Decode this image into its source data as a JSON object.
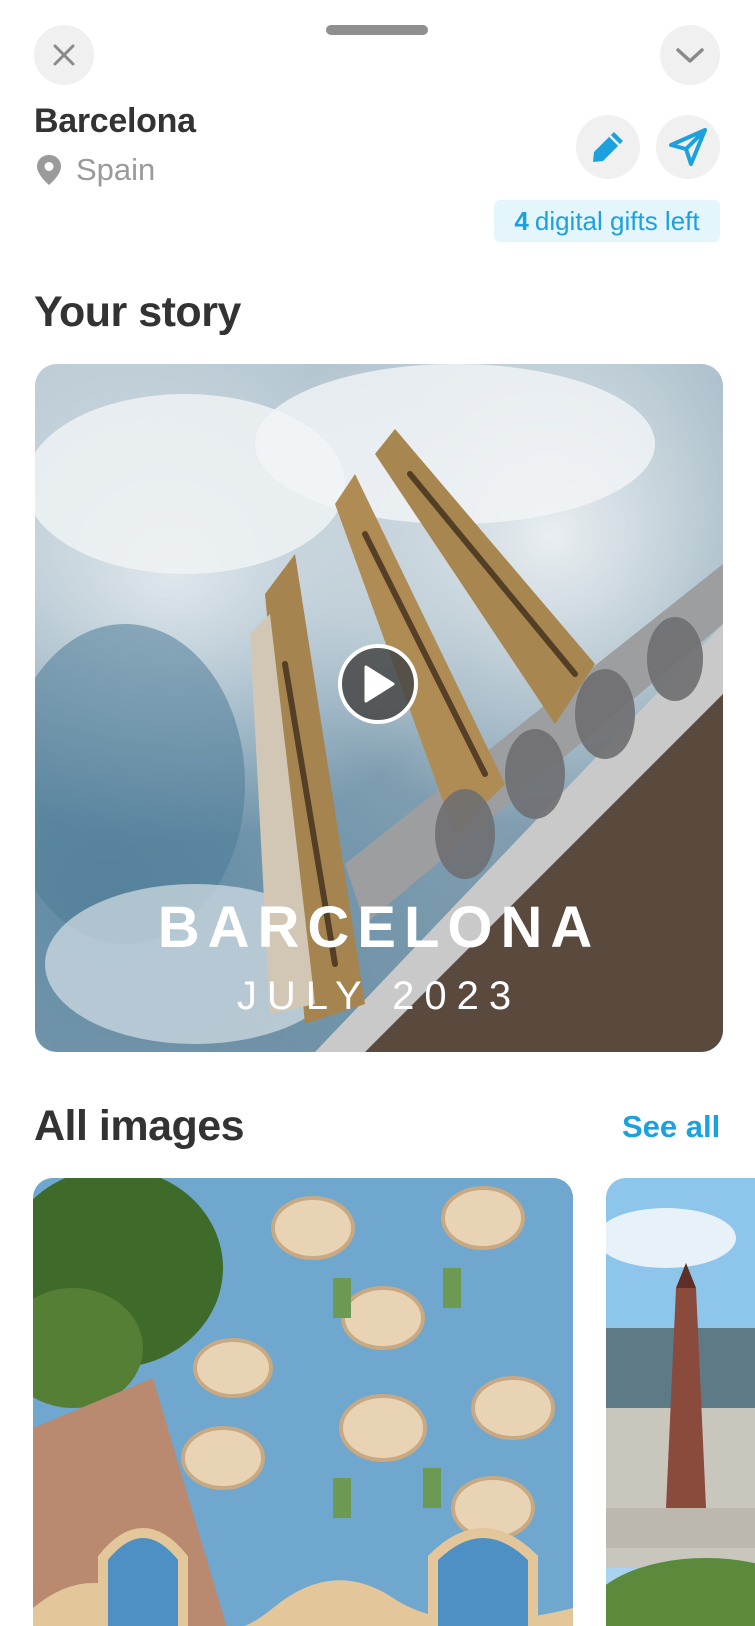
{
  "header": {
    "close_icon": "close-icon",
    "collapse_icon": "chevron-down-icon"
  },
  "place": {
    "city": "Barcelona",
    "country": "Spain",
    "location_icon": "location-pin-icon"
  },
  "actions": {
    "edit_icon": "pencil-icon",
    "send_icon": "paper-plane-icon"
  },
  "gifts": {
    "count": "4",
    "label": "digital gifts left"
  },
  "story": {
    "section_title": "Your story",
    "card_title": "BARCELONA",
    "card_subtitle": "JULY 2023",
    "play_icon": "play-icon"
  },
  "images": {
    "section_title": "All images",
    "see_all_label": "See all",
    "items": [
      {
        "name": "casa-batllo-photo"
      },
      {
        "name": "placa-espanya-photo"
      }
    ]
  },
  "colors": {
    "accent": "#1da1de",
    "badge_bg": "#e4f5fc",
    "title_text": "#333333",
    "muted_text": "#9a9a9a",
    "button_bg": "#f0f0f0"
  }
}
